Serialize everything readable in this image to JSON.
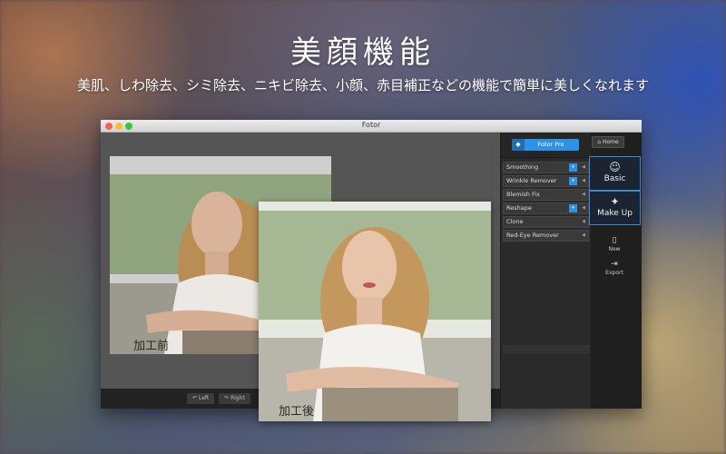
{
  "promo": {
    "headline": "美顔機能",
    "subline": "美肌、しわ除去、シミ除去、ニキビ除去、小顔、赤目補正などの機能で簡単に美しくなれます"
  },
  "window": {
    "title": "Fotor"
  },
  "canvas": {
    "before_label": "加工前",
    "after_label": "加工後",
    "rotate_left": "Left",
    "rotate_right": "Right"
  },
  "panel": {
    "pro_button": "Fotor Pro",
    "home_button": "Home",
    "tools": [
      {
        "label": "Smoothing",
        "pro": true
      },
      {
        "label": "Wrinkle Remover",
        "pro": true
      },
      {
        "label": "Blemish Fix",
        "pro": false
      },
      {
        "label": "Reshape",
        "pro": true
      },
      {
        "label": "Clone",
        "pro": false
      },
      {
        "label": "Red-Eye Remover",
        "pro": false
      }
    ]
  },
  "side": {
    "tab_basic": "Basic",
    "tab_makeup": "Make Up",
    "new_label": "New",
    "export_label": "Export"
  },
  "colors": {
    "accent": "#2d93e6",
    "selected_border": "#3a8ad8"
  },
  "icons": [
    "home-icon",
    "gem-icon",
    "chevron-left-icon",
    "face-icon",
    "makeup-icon",
    "new-file-icon",
    "export-icon",
    "rotate-left-icon",
    "rotate-right-icon"
  ]
}
